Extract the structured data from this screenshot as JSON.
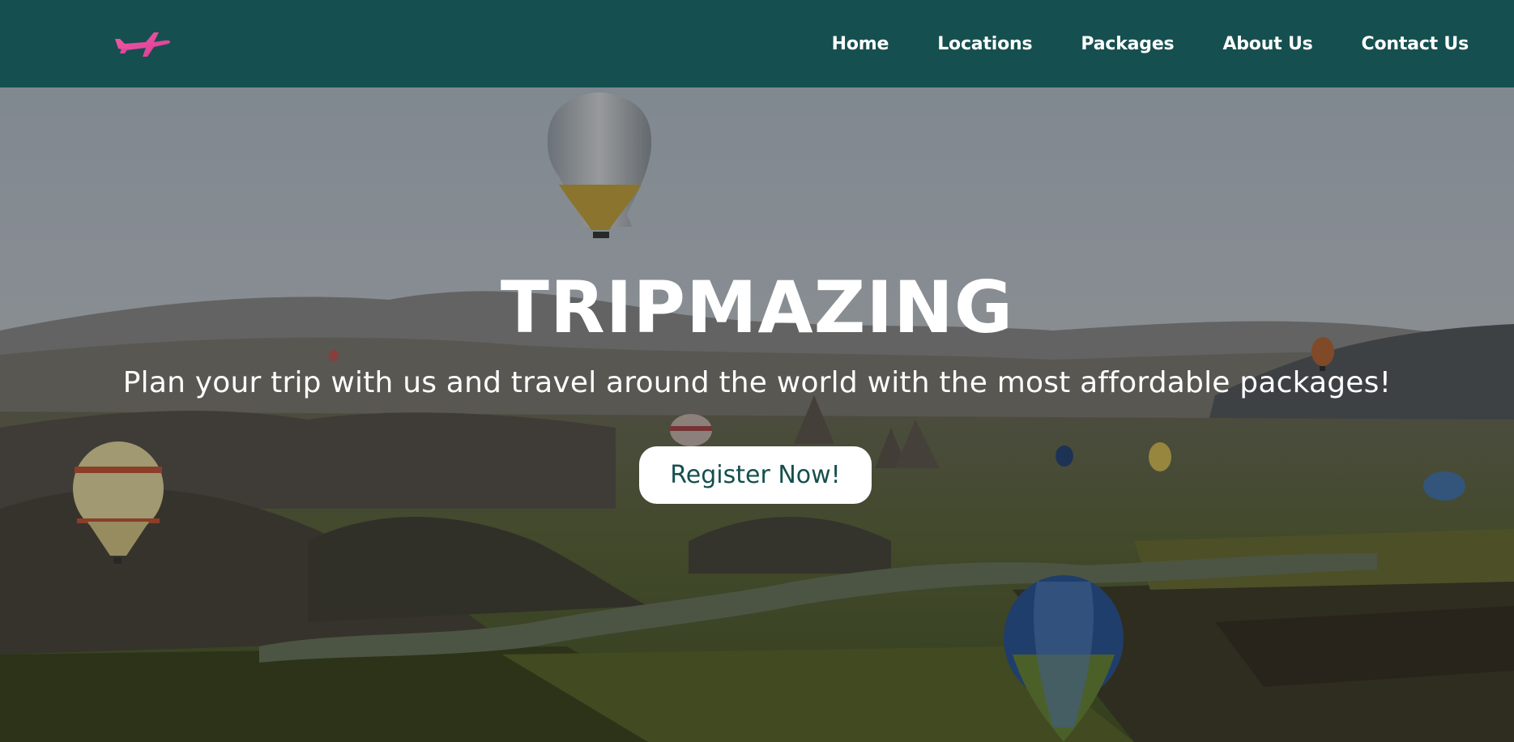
{
  "brand": {
    "logo_icon": "airplane-icon",
    "logo_color": "#ec4fa5"
  },
  "nav": {
    "items": [
      {
        "label": "Home"
      },
      {
        "label": "Locations"
      },
      {
        "label": "Packages"
      },
      {
        "label": "About Us"
      },
      {
        "label": "Contact Us"
      }
    ]
  },
  "hero": {
    "title": "TRIPMAZING",
    "subtitle": "Plan your trip with us and travel around the world with the most affordable packages!",
    "cta_label": "Register Now!",
    "background": "hot-air-balloons-landscape-photo"
  },
  "colors": {
    "navbar_bg": "#164f4f",
    "accent_pink": "#ec4fa5",
    "button_bg": "#ffffff",
    "button_text": "#164f4f"
  }
}
